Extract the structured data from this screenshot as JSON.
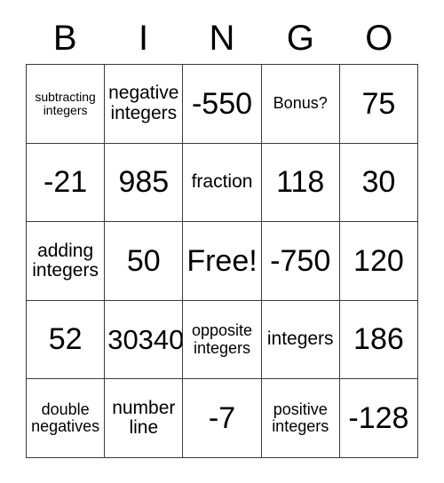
{
  "card": {
    "headers": [
      "B",
      "I",
      "N",
      "G",
      "O"
    ],
    "rows": [
      [
        {
          "text": "subtracting integers",
          "size": "xs"
        },
        {
          "text": "negative integers",
          "size": "md"
        },
        {
          "text": "-550",
          "size": "xl"
        },
        {
          "text": "Bonus?",
          "size": "sm"
        },
        {
          "text": "75",
          "size": "xl"
        }
      ],
      [
        {
          "text": "-21",
          "size": "xl"
        },
        {
          "text": "985",
          "size": "xl"
        },
        {
          "text": "fraction",
          "size": "md"
        },
        {
          "text": "118",
          "size": "xl"
        },
        {
          "text": "30",
          "size": "xl"
        }
      ],
      [
        {
          "text": "adding integers",
          "size": "md"
        },
        {
          "text": "50",
          "size": "xl"
        },
        {
          "text": "Free!",
          "size": "xl"
        },
        {
          "text": "-750",
          "size": "xl"
        },
        {
          "text": "120",
          "size": "xl"
        }
      ],
      [
        {
          "text": "52",
          "size": "xl"
        },
        {
          "text": "30340",
          "size": "lg"
        },
        {
          "text": "opposite integers",
          "size": "sm"
        },
        {
          "text": "integers",
          "size": "md"
        },
        {
          "text": "186",
          "size": "xl"
        }
      ],
      [
        {
          "text": "double negatives",
          "size": "sm"
        },
        {
          "text": "number line",
          "size": "md"
        },
        {
          "text": "-7",
          "size": "xl"
        },
        {
          "text": "positive integers",
          "size": "sm"
        },
        {
          "text": "-128",
          "size": "xl"
        }
      ]
    ]
  },
  "colors": {
    "border": "#3a3a3a",
    "text": "#000000",
    "background": "#ffffff"
  }
}
